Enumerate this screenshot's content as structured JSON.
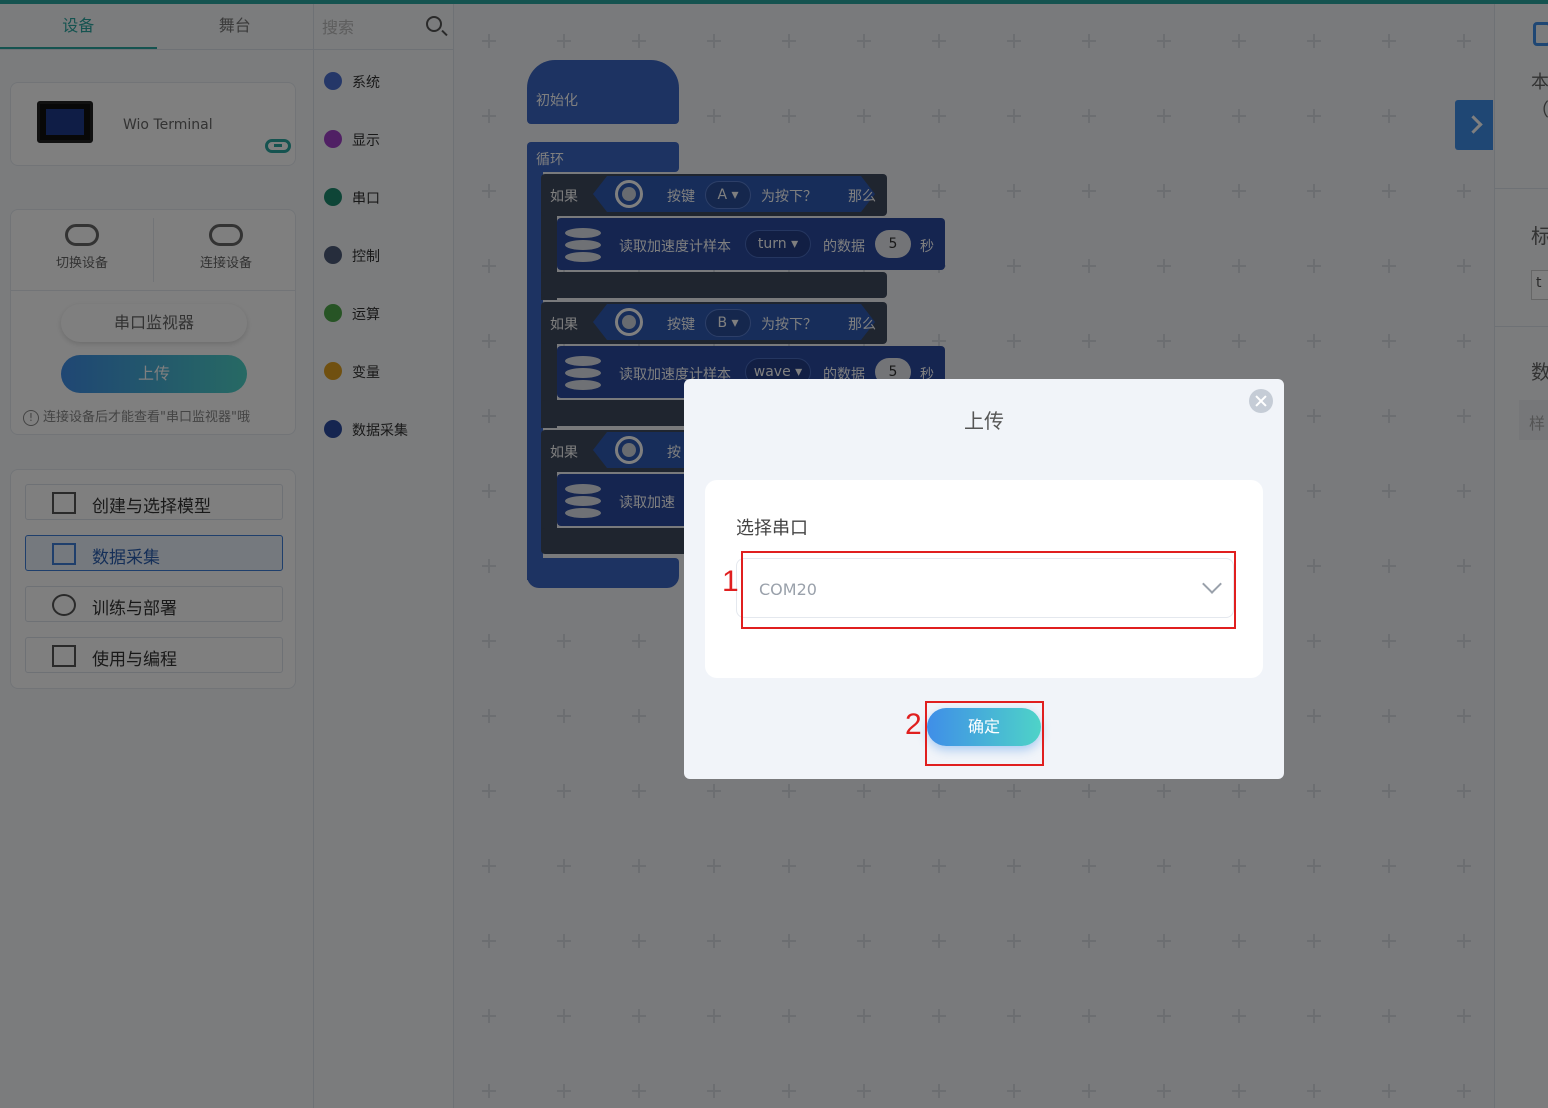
{
  "left_panel": {
    "tabs": [
      "设备",
      "舞台"
    ],
    "device_name": "Wio Terminal",
    "switch_device": "切换设备",
    "connect_device": "连接设备",
    "serial_monitor": "串口监视器",
    "upload": "上传",
    "hint": "连接设备后才能查看\"串口监视器\"哦",
    "nav": [
      "创建与选择模型",
      "数据采集",
      "训练与部署",
      "使用与编程"
    ],
    "nav_selected": "数据采集"
  },
  "categories": {
    "search_placeholder": "搜索",
    "items": [
      {
        "label": "系统",
        "color": "#4a6fd0"
      },
      {
        "label": "显示",
        "color": "#a040c8"
      },
      {
        "label": "串口",
        "color": "#1c8a6e"
      },
      {
        "label": "控制",
        "color": "#4d5a78"
      },
      {
        "label": "运算",
        "color": "#4fa84a"
      },
      {
        "label": "变量",
        "color": "#e0a020"
      },
      {
        "label": "数据采集",
        "color": "#2a4aa0"
      }
    ]
  },
  "blocks": {
    "init": "初始化",
    "loop": "循环",
    "if_1": {
      "if": "如果",
      "key": "按键",
      "key_value": "A",
      "pressed": "为按下？",
      "then": "那么"
    },
    "read_1": {
      "text": "读取加速度计样本",
      "label": "turn",
      "data_of": "的数据",
      "seconds": "5",
      "unit": "秒"
    },
    "if_2": {
      "if": "如果",
      "key": "按键",
      "key_value": "B",
      "pressed": "为按下？",
      "then": "那么"
    },
    "read_2": {
      "text": "读取加速度计样本",
      "label": "wave",
      "data_of": "的数据",
      "seconds": "5",
      "unit": "秒"
    },
    "if_3": {
      "if": "如果",
      "key": "按"
    },
    "read_3": {
      "text": "读取加速"
    }
  },
  "right_panel": {
    "t1": "本",
    "t2": "（",
    "t3": "标",
    "t4": "t",
    "t5": "数",
    "t6": "样"
  },
  "modal": {
    "title": "上传",
    "select_label": "选择串口",
    "selected_port": "COM20",
    "confirm": "确定",
    "annotation_1": "1",
    "annotation_2": "2"
  }
}
